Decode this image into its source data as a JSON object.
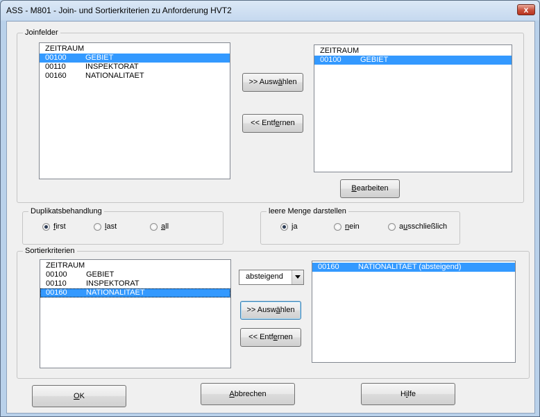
{
  "window": {
    "title": "ASS - M801 - Join- und Sortierkriterien zu Anforderung HVT2",
    "close_glyph": "x"
  },
  "joinfelder": {
    "legend": "Joinfelder",
    "left_list": [
      {
        "code": "ZEITRAUM",
        "label": ""
      },
      {
        "code": "00100",
        "label": "GEBIET"
      },
      {
        "code": "00110",
        "label": "INSPEKTORAT"
      },
      {
        "code": "00160",
        "label": "NATIONALITAET"
      }
    ],
    "right_list": [
      {
        "code": "ZEITRAUM",
        "label": ""
      },
      {
        "code": "00100",
        "label": "GEBIET"
      }
    ],
    "select_button": {
      "prefix": ">> Ausw",
      "mnemonic": "ä",
      "suffix": "hlen"
    },
    "remove_button": {
      "prefix": "<< Entf",
      "mnemonic": "e",
      "suffix": "rnen"
    },
    "edit_button": {
      "prefix": "",
      "mnemonic": "B",
      "suffix": "earbeiten"
    }
  },
  "duplikate": {
    "legend": "Duplikatsbehandlung",
    "options": [
      {
        "mnemonic": "f",
        "rest": "irst",
        "selected": true
      },
      {
        "mnemonic": "l",
        "rest": "ast",
        "selected": false
      },
      {
        "mnemonic": "a",
        "rest": "ll",
        "selected": false
      }
    ]
  },
  "leere_menge": {
    "legend": "leere Menge darstellen",
    "options": [
      {
        "pre": "",
        "mnemonic": "j",
        "rest": "a",
        "selected": true
      },
      {
        "pre": "",
        "mnemonic": "n",
        "rest": "ein",
        "selected": false
      },
      {
        "pre": "a",
        "mnemonic": "u",
        "rest": "sschließlich",
        "selected": false
      }
    ]
  },
  "sortier": {
    "legend": "Sortierkriterien",
    "left_list": [
      {
        "code": "ZEITRAUM",
        "label": ""
      },
      {
        "code": "00100",
        "label": "GEBIET"
      },
      {
        "code": "00110",
        "label": "INSPEKTORAT"
      },
      {
        "code": "00160",
        "label": "NATIONALITAET"
      }
    ],
    "order_combo": "absteigend",
    "right_list": [
      {
        "code": "00160",
        "label": "NATIONALITAET (absteigend)"
      }
    ],
    "select_button": {
      "prefix": ">> Ausw",
      "mnemonic": "ä",
      "suffix": "hlen"
    },
    "remove_button": {
      "prefix": "<< Entf",
      "mnemonic": "e",
      "suffix": "rnen"
    }
  },
  "footer": {
    "ok": {
      "prefix": "",
      "mnemonic": "O",
      "suffix": "K"
    },
    "cancel": {
      "prefix": "",
      "mnemonic": "A",
      "suffix": "bbrechen"
    },
    "help": {
      "prefix": "H",
      "mnemonic": "i",
      "suffix": "lfe"
    }
  },
  "colors": {
    "selection": "#3399ff",
    "title_bg": "#c6d9ef",
    "client_bg": "#f0f0f0"
  }
}
